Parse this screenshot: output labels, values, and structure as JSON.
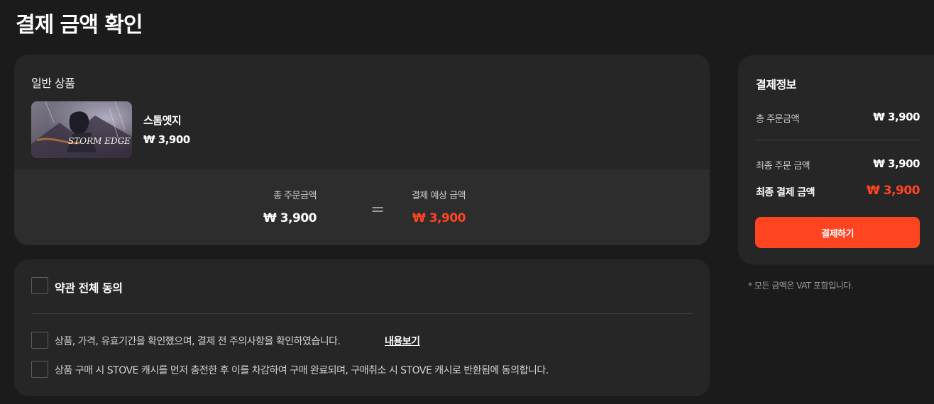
{
  "page": {
    "title": "결제 금액 확인"
  },
  "product_section": {
    "label": "일반 상품",
    "product": {
      "name": "스톰엣지",
      "price": "₩ 3,900",
      "thumbnail_logo": "STORM EDGE"
    },
    "summary": {
      "total_label": "총 주문금액",
      "total_value": "₩ 3,900",
      "equals": "=",
      "expected_label": "결제 예상 금액",
      "expected_value": "₩ 3,900"
    }
  },
  "agreement": {
    "all_label": "약관 전체 동의",
    "items": [
      {
        "text": "상품, 가격, 유효기간을 확인했으며, 결제 전 주의사항을 확인하였습니다.",
        "link": "내용보기"
      },
      {
        "text": "상품 구매 시 STOVE 캐시를 먼저 충전한 후 이를 차감하여 구매 완료되며, 구매취소 시 STOVE 캐시로 반환됨에 동의합니다."
      }
    ]
  },
  "payment_info": {
    "title": "결제정보",
    "total_order_label": "총 주문금액",
    "total_order_value": "₩ 3,900",
    "final_order_label": "최종 주문 금액",
    "final_order_value": "₩ 3,900",
    "final_pay_label": "최종 결제 금액",
    "final_pay_value": "₩ 3,900",
    "pay_button": "결제하기",
    "vat_note": "* 모든 금액은 VAT 포함입니다."
  },
  "colors": {
    "accent": "#ff4422",
    "background": "#1b1b1b",
    "card": "#262626"
  }
}
